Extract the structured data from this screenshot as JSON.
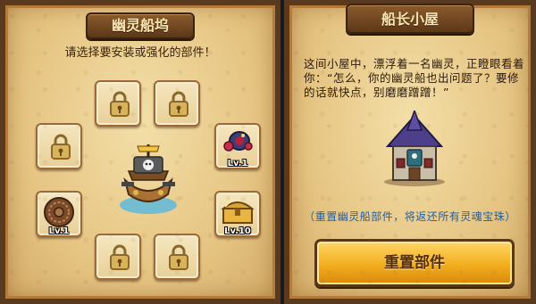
{
  "left_panel": {
    "title": "幽灵船坞",
    "subtitle": "请选择要安装或强化的部件！",
    "slots": [
      {
        "icon": "padlock-icon",
        "locked": true
      },
      {
        "icon": "padlock-icon",
        "locked": true
      },
      {
        "icon": "padlock-icon",
        "locked": true
      },
      {
        "icon": "cannon-icon",
        "locked": false,
        "level": "Lv.1"
      },
      {
        "icon": "round-shield-icon",
        "locked": false,
        "level": "Lv.1"
      },
      {
        "icon": "treasure-chest-icon",
        "locked": false,
        "level": "Lv.10"
      },
      {
        "icon": "padlock-icon",
        "locked": true
      },
      {
        "icon": "padlock-icon",
        "locked": true
      }
    ],
    "center_icon": "ghost-ship-icon"
  },
  "right_panel": {
    "title": "船长小屋",
    "description": "这间小屋中，漂浮着一名幽灵，正瞪眼看着你：“怎么，你的幽灵船也出问题了？要修的话就快点，别磨磨蹭蹭！”",
    "illustration": "captain-house-icon",
    "reset_note": "（重置幽灵船部件，将返还所有灵魂宝珠）",
    "reset_button_label": "重置部件"
  },
  "colors": {
    "parchment": "#e6c583",
    "frame": "#5a3a1f",
    "button": "#f2ae1e",
    "note_text": "#1f5fa8"
  }
}
